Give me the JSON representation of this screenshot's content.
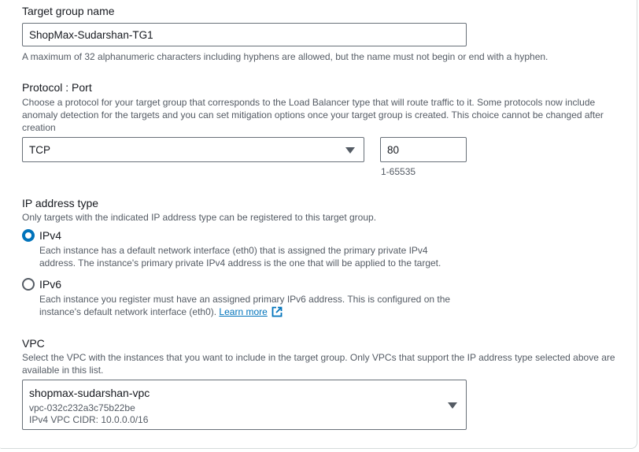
{
  "target_group_name": {
    "label": "Target group name",
    "value": "ShopMax-Sudarshan-TG1",
    "hint": "A maximum of 32 alphanumeric characters including hyphens are allowed, but the name must not begin or end with a hyphen."
  },
  "protocol_port": {
    "label": "Protocol : Port",
    "description": "Choose a protocol for your target group that corresponds to the Load Balancer type that will route traffic to it. Some protocols now include anomaly detection for the targets and you can set mitigation options once your target group is created. This choice cannot be changed after creation",
    "protocol": "TCP",
    "port": "80",
    "port_hint": "1-65535"
  },
  "ip_address_type": {
    "label": "IP address type",
    "description": "Only targets with the indicated IP address type can be registered to this target group.",
    "options": [
      {
        "label": "IPv4",
        "selected": true,
        "description": "Each instance has a default network interface (eth0) that is assigned the primary private IPv4 address. The instance's primary private IPv4 address is the one that will be applied to the target."
      },
      {
        "label": "IPv6",
        "selected": false,
        "description": "Each instance you register must have an assigned primary IPv6 address. This is configured on the instance's default network interface (eth0).",
        "link": "Learn more"
      }
    ]
  },
  "vpc": {
    "label": "VPC",
    "description": "Select the VPC with the instances that you want to include in the target group. Only VPCs that support the IP address type selected above are available in this list.",
    "selected_name": "shopmax-sudarshan-vpc",
    "selected_id": "vpc-032c232a3c75b22be",
    "selected_cidr": "IPv4 VPC CIDR: 10.0.0.0/16"
  },
  "colors": {
    "accent": "#0073bb",
    "text": "#16191f",
    "muted": "#545b64",
    "border": "#687078"
  },
  "icons": [
    "caret-down-icon",
    "external-link-icon",
    "radio-icon"
  ]
}
